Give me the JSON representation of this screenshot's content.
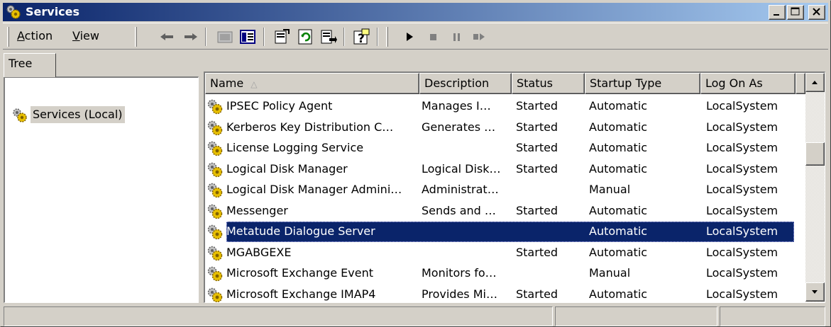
{
  "window": {
    "title": "Services",
    "title_bar_colors": [
      "#0a246a",
      "#a6caf0"
    ],
    "controls": [
      {
        "name": "minimize",
        "icon": "minimize-icon"
      },
      {
        "name": "maximize",
        "icon": "maximize-icon"
      },
      {
        "name": "close",
        "icon": "close-icon"
      }
    ]
  },
  "menu": {
    "action": {
      "accel": "A",
      "rest": "ction"
    },
    "view": {
      "accel": "V",
      "rest": "iew"
    }
  },
  "toolbar": {
    "icons": [
      "back-arrow-icon",
      "forward-arrow-icon",
      "up-folder-icon",
      "show-hide-tree-icon",
      "properties-icon",
      "refresh-icon",
      "export-list-icon",
      "help-icon",
      "start-service-icon",
      "stop-service-icon",
      "pause-service-icon",
      "restart-service-icon"
    ]
  },
  "tree": {
    "tab_label": "Tree",
    "items": [
      {
        "label": "Services (Local)",
        "icon": "services-gear-icon"
      }
    ]
  },
  "list": {
    "columns": [
      "Name",
      "Description",
      "Status",
      "Startup Type",
      "Log On As"
    ],
    "sorted_column": "Name",
    "rows": [
      {
        "name": "IPSEC Policy Agent",
        "description": "Manages I…",
        "status": "Started",
        "startup": "Automatic",
        "logon": "LocalSystem"
      },
      {
        "name": "Kerberos Key Distribution C…",
        "description": "Generates …",
        "status": "Started",
        "startup": "Automatic",
        "logon": "LocalSystem"
      },
      {
        "name": "License Logging Service",
        "description": "",
        "status": "Started",
        "startup": "Automatic",
        "logon": "LocalSystem"
      },
      {
        "name": "Logical Disk Manager",
        "description": "Logical Disk…",
        "status": "Started",
        "startup": "Automatic",
        "logon": "LocalSystem"
      },
      {
        "name": "Logical Disk Manager Admini…",
        "description": "Administrat…",
        "status": "",
        "startup": "Manual",
        "logon": "LocalSystem"
      },
      {
        "name": "Messenger",
        "description": "Sends and …",
        "status": "Started",
        "startup": "Automatic",
        "logon": "LocalSystem"
      },
      {
        "name": "Metatude Dialogue Server",
        "description": "",
        "status": "",
        "startup": "Automatic",
        "logon": "LocalSystem",
        "selected": true
      },
      {
        "name": "MGABGEXE",
        "description": "",
        "status": "Started",
        "startup": "Automatic",
        "logon": "LocalSystem"
      },
      {
        "name": "Microsoft Exchange Event",
        "description": "Monitors fo…",
        "status": "",
        "startup": "Manual",
        "logon": "LocalSystem"
      },
      {
        "name": "Microsoft Exchange IMAP4",
        "description": "Provides Mi…",
        "status": "Started",
        "startup": "Automatic",
        "logon": "LocalSystem"
      }
    ],
    "selection_color": "#0a246a"
  },
  "statusbar": {
    "panes": [
      "",
      "",
      ""
    ]
  }
}
